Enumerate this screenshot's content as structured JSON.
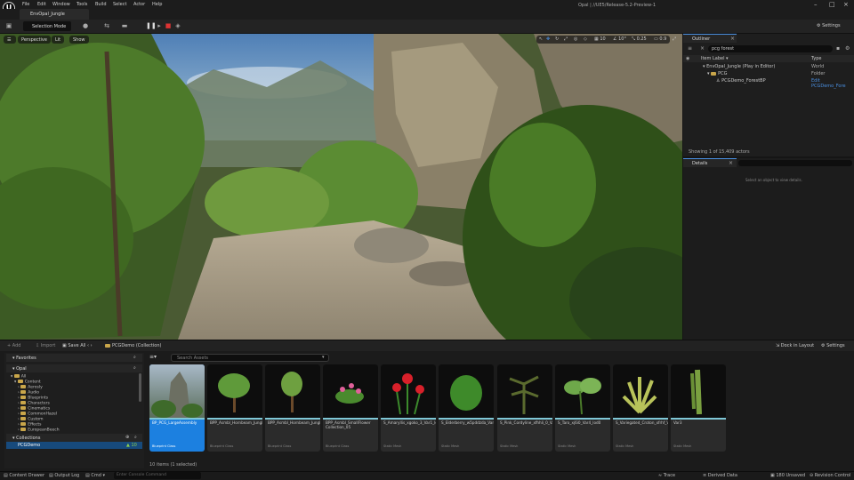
{
  "menu": {
    "items": [
      "File",
      "Edit",
      "Window",
      "Tools",
      "Build",
      "Select",
      "Actor",
      "Help"
    ],
    "project_title": "Opal | //UE5/Release-5.2-Preview-1"
  },
  "tab": {
    "level": "EnvOpal_Jungle"
  },
  "toolbar": {
    "mode": "Selection Mode",
    "settings": "Settings"
  },
  "viewport": {
    "perspective": "Perspective",
    "lit": "Lit",
    "show": "Show",
    "grid_snap": "10",
    "rot_snap": "10°",
    "scale_snap": "0.25",
    "camera_speed": "0.9"
  },
  "outliner": {
    "title": "Outliner",
    "search_value": "pcg forest",
    "col_label": "Item Label",
    "col_type": "Type",
    "rows": [
      {
        "label": "EnvOpal_Jungle (Play in Editor)",
        "type": "World"
      },
      {
        "label": "PCG",
        "type": "Folder"
      },
      {
        "label": "PCGDemo_ForestBP",
        "type": "Edit PCGDemo_Fore"
      }
    ],
    "footer": "Showing 1 of 15,409 actors"
  },
  "details": {
    "title": "Details",
    "empty_msg": "Select an object to view details."
  },
  "content_browser": {
    "add": "+ Add",
    "import": "Import",
    "save_all": "Save All",
    "path": "PCGDemo (Collection)",
    "dock": "Dock in Layout",
    "settings": "Settings",
    "search_placeholder": "Search Assets",
    "favorites": "Favorites",
    "project": "Opal",
    "tree": [
      "All",
      "Content",
      "Aerosly",
      "Audio",
      "Blueprints",
      "Characters",
      "Cinematics",
      "CommonHazel",
      "Custom",
      "Effects",
      "EuropeanBeech"
    ],
    "collections": "Collections",
    "collection_item": "PCGDemo",
    "collection_count": "10",
    "assets": [
      {
        "name": "BP_PCG_LargeAssembly",
        "type": "Blueprint Class"
      },
      {
        "name": "BPP_Asmbl_Hornbeam_JungleVersion_03",
        "type": "Blueprint Class"
      },
      {
        "name": "BPP_Asmbl_Hornbeam_JungleVersion_05",
        "type": "Blueprint Class"
      },
      {
        "name": "BPP_Asmbl_SmallFlower Collection_05",
        "type": "Blueprint Class"
      },
      {
        "name": "S_Amaryllis_xgoko_3_Var1_lod0",
        "type": "Static Mesh"
      },
      {
        "name": "S_Elderberry_w5pddzda_Var3_lod0",
        "type": "Static Mesh"
      },
      {
        "name": "S_Pink_Cordyline_xfhhli_0_Var4_lod0",
        "type": "Static Mesh"
      },
      {
        "name": "S_Taro_xj6i0_Var4_lod0",
        "type": "Static Mesh"
      },
      {
        "name": "S_Variegated_Croton_xfrhf_Var4_lod0",
        "type": "Static Mesh"
      },
      {
        "name": "Var3",
        "type": "Static Mesh"
      }
    ],
    "items_count": "10 items (1 selected)"
  },
  "status": {
    "content_drawer": "Content Drawer",
    "output_log": "Output Log",
    "cmd": "Cmd",
    "cmd_placeholder": "Enter Console Command",
    "trace": "Trace",
    "derived": "Derived Data",
    "unsaved": "180 Unsaved",
    "revision": "Revision Control"
  }
}
